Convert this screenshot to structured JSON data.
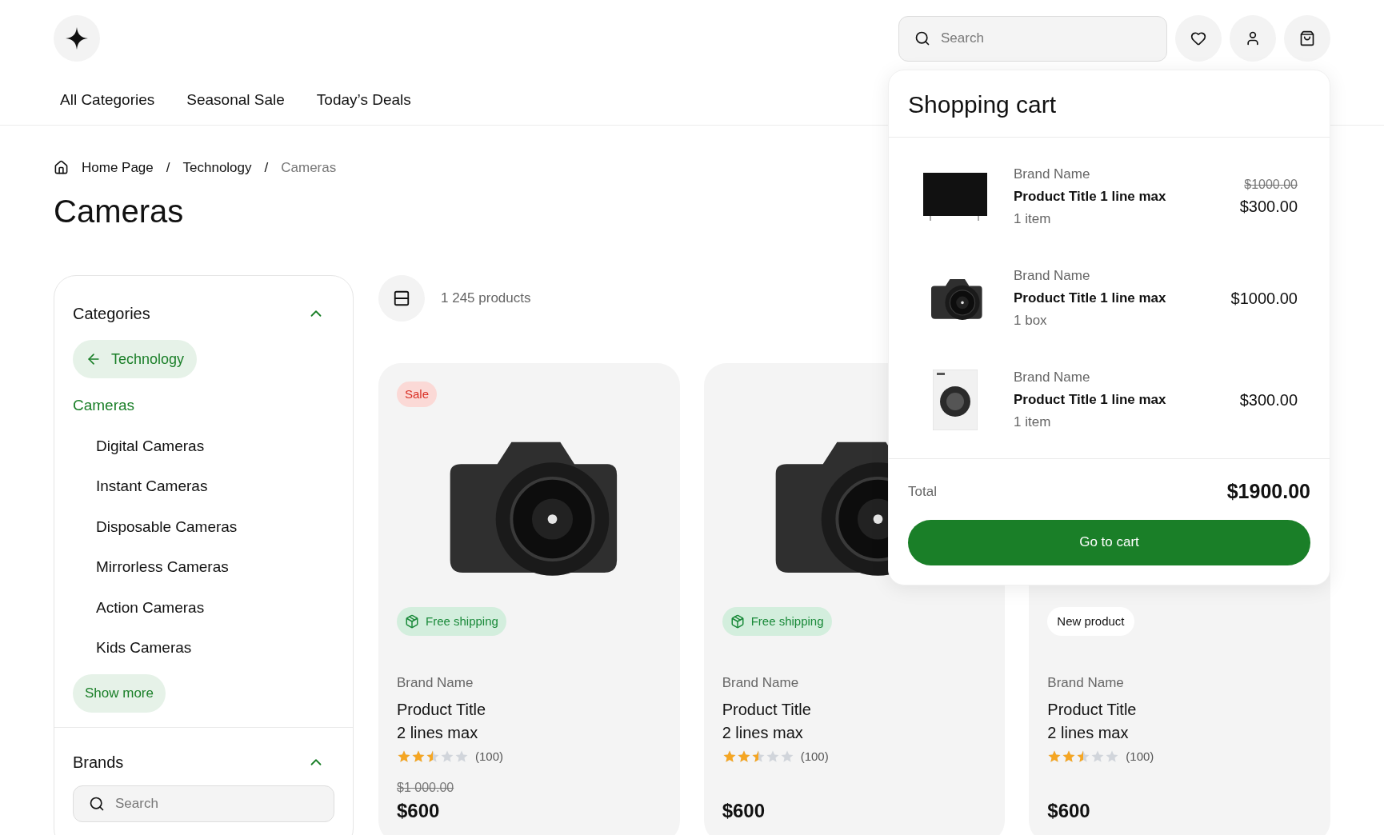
{
  "header": {
    "search": {
      "placeholder": "Search"
    },
    "nav": [
      "All Categories",
      "Seasonal Sale",
      "Today’s Deals"
    ]
  },
  "breadcrumb": {
    "separator": "/",
    "items": [
      "Home Page",
      "Technology",
      "Cameras"
    ]
  },
  "page_title": "Cameras",
  "sidebar": {
    "categories": {
      "title": "Categories",
      "expanded": true,
      "back": "Technology",
      "current": "Cameras",
      "items": [
        "Digital Cameras",
        "Instant Cameras",
        "Disposable Cameras",
        "Mirrorless Cameras",
        "Action Cameras",
        "Kids Cameras"
      ],
      "show_more": "Show more"
    },
    "brands": {
      "title": "Brands",
      "expanded": true,
      "search": {
        "placeholder": "Search"
      }
    }
  },
  "toolbar": {
    "count": "1 245 products"
  },
  "products": [
    {
      "tag": {
        "kind": "sale",
        "label": "Sale"
      },
      "badge": {
        "kind": "shipping",
        "label": "Free shipping"
      },
      "brand": "Brand Name",
      "title": "Product Title",
      "title_line_2": "2 lines max",
      "stars": 2.5,
      "reviews": "(100)",
      "old_price": "$1 000.00",
      "price": "$600"
    },
    {
      "badge": {
        "kind": "shipping",
        "label": "Free shipping"
      },
      "brand": "Brand Name",
      "title": "Product Title",
      "title_line_2": "2 lines max",
      "stars": 2.5,
      "reviews": "(100)",
      "price": "$600"
    },
    {
      "badge": {
        "kind": "new",
        "label": "New product"
      },
      "brand": "Brand Name",
      "title": "Product Title",
      "title_line_2": "2 lines max",
      "stars": 2.5,
      "reviews": "(100)",
      "price": "$600"
    }
  ],
  "cart": {
    "title": "Shopping cart",
    "items": [
      {
        "kind": "tv",
        "brand": "Brand Name",
        "title": "Product Title 1 line max",
        "quantity": "1 item",
        "old_price": "$1000.00",
        "price": "$300.00"
      },
      {
        "kind": "camera",
        "brand": "Brand Name",
        "title": "Product Title 1 line max",
        "quantity": "1 box",
        "price": "$1000.00"
      },
      {
        "kind": "washer",
        "brand": "Brand Name",
        "title": "Product Title 1 line max",
        "quantity": "1 item",
        "price": "$300.00"
      }
    ],
    "total_label": "Total",
    "total": "$1900.00",
    "button": "Go to cart"
  }
}
